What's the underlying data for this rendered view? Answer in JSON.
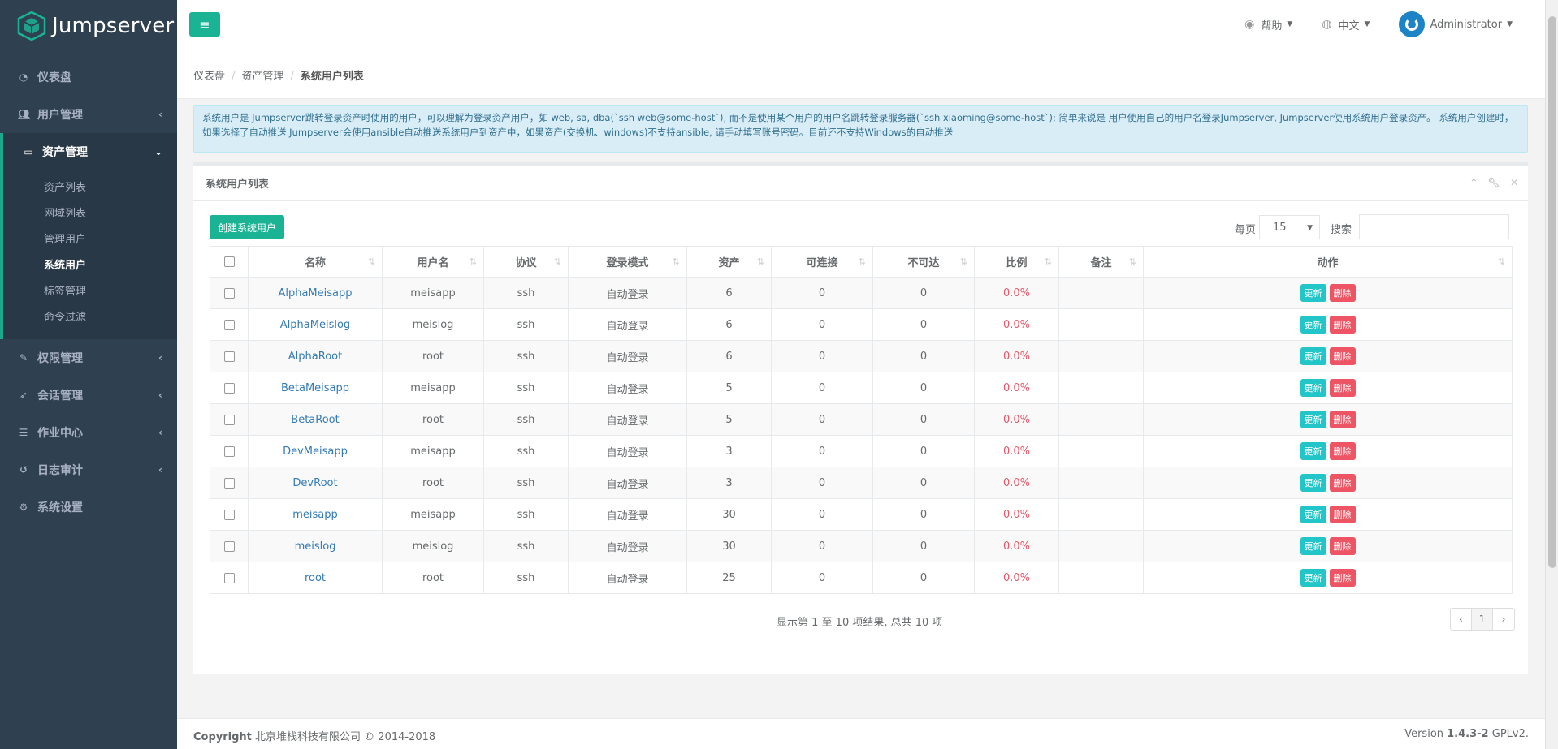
{
  "app": {
    "logo_text": "Jumpserver"
  },
  "sidebar": {
    "items": [
      {
        "label": "仪表盘",
        "icon": "dashboard-icon"
      },
      {
        "label": "用户管理",
        "icon": "users-icon"
      },
      {
        "label": "资产管理",
        "icon": "inbox-icon"
      },
      {
        "label": "权限管理",
        "icon": "edit-icon"
      },
      {
        "label": "会话管理",
        "icon": "rocket-icon"
      },
      {
        "label": "作业中心",
        "icon": "tasks-icon"
      },
      {
        "label": "日志审计",
        "icon": "history-icon"
      },
      {
        "label": "系统设置",
        "icon": "gears-icon"
      }
    ],
    "sub_items": [
      "资产列表",
      "网域列表",
      "管理用户",
      "系统用户",
      "标签管理",
      "命令过滤"
    ]
  },
  "topbar": {
    "help": "帮助",
    "language": "中文",
    "user": "Administrator"
  },
  "breadcrumb": {
    "home": "仪表盘",
    "section": "资产管理",
    "current": "系统用户列表"
  },
  "alert": {
    "text": "系统用户是 Jumpserver跳转登录资产时使用的用户，可以理解为登录资产用户，如 web, sa, dba(`ssh web@some-host`), 而不是使用某个用户的用户名跳转登录服务器(`ssh xiaoming@some-host`); 简单来说是 用户使用自己的用户名登录Jumpserver, Jumpserver使用系统用户登录资产。 系统用户创建时，如果选择了自动推送 Jumpserver会使用ansible自动推送系统用户到资产中，如果资产(交换机、windows)不支持ansible, 请手动填写账号密码。目前还不支持Windows的自动推送"
  },
  "panel": {
    "title": "系统用户列表",
    "create_button": "创建系统用户",
    "page_length_label": "每页",
    "page_length_value": "15",
    "search_label": "搜索",
    "columns": [
      "名称",
      "用户名",
      "协议",
      "登录模式",
      "资产",
      "可连接",
      "不可达",
      "比例",
      "备注",
      "动作"
    ],
    "rows": [
      [
        "AlphaMeisapp",
        "meisapp",
        "ssh",
        "自动登录",
        "6",
        "0",
        "0",
        "0.0%",
        ""
      ],
      [
        "AlphaMeislog",
        "meislog",
        "ssh",
        "自动登录",
        "6",
        "0",
        "0",
        "0.0%",
        ""
      ],
      [
        "AlphaRoot",
        "root",
        "ssh",
        "自动登录",
        "6",
        "0",
        "0",
        "0.0%",
        ""
      ],
      [
        "BetaMeisapp",
        "meisapp",
        "ssh",
        "自动登录",
        "5",
        "0",
        "0",
        "0.0%",
        ""
      ],
      [
        "BetaRoot",
        "root",
        "ssh",
        "自动登录",
        "5",
        "0",
        "0",
        "0.0%",
        ""
      ],
      [
        "DevMeisapp",
        "meisapp",
        "ssh",
        "自动登录",
        "3",
        "0",
        "0",
        "0.0%",
        ""
      ],
      [
        "DevRoot",
        "root",
        "ssh",
        "自动登录",
        "3",
        "0",
        "0",
        "0.0%",
        ""
      ],
      [
        "meisapp",
        "meisapp",
        "ssh",
        "自动登录",
        "30",
        "0",
        "0",
        "0.0%",
        ""
      ],
      [
        "meislog",
        "meislog",
        "ssh",
        "自动登录",
        "30",
        "0",
        "0",
        "0.0%",
        ""
      ],
      [
        "root",
        "root",
        "ssh",
        "自动登录",
        "25",
        "0",
        "0",
        "0.0%",
        ""
      ]
    ],
    "update_label": "更新",
    "delete_label": "删除",
    "info": "显示第 1 至 10 项结果, 总共 10 项",
    "pager": {
      "prev": "‹",
      "page": "1",
      "next": "›"
    }
  },
  "footer": {
    "copyright_bold": "Copyright",
    "copyright_rest": " 北京堆栈科技有限公司 © 2014-2018",
    "version_prefix": "Version ",
    "version_bold": "1.4.3-2",
    "version_suffix": " GPLv2."
  },
  "colors": {
    "sidebar": "#2f4050",
    "accent": "#1ab394",
    "info": "#23c6c8",
    "danger": "#ed5565"
  }
}
